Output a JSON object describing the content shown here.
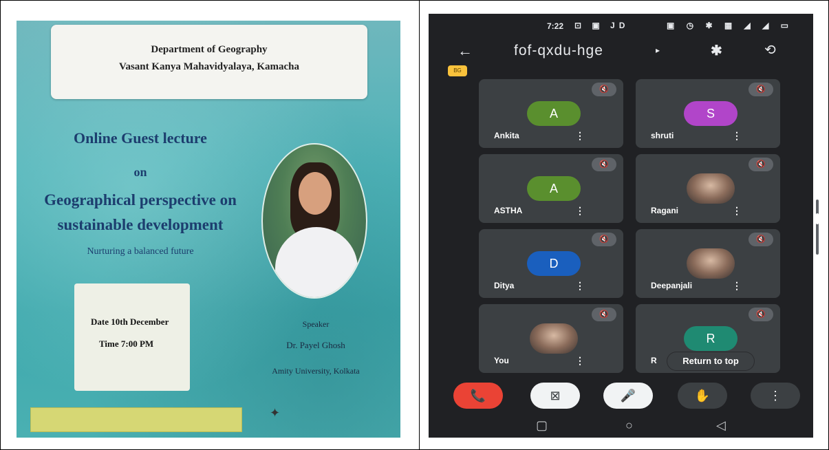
{
  "poster": {
    "dept": "Department of Geography",
    "college": "Vasant Kanya Mahavidyalaya, Kamacha",
    "line1": "Online Guest lecture",
    "line2": "on",
    "line3": "Geographical perspective on",
    "line4": "sustainable development",
    "line5": "Nurturing a balanced future",
    "date": "Date  10th December",
    "time": "Time  7:00 PM",
    "speaker_label": "Speaker",
    "speaker_name": "Dr. Payel Ghosh",
    "speaker_affil": "Amity University, Kolkata"
  },
  "phone": {
    "status_time": "7:22",
    "status_left_icons": "⊡ ▣ JD",
    "status_right_icons": "▣ ◷ ✱ ▦ ◢ ◢ ▭",
    "meeting_code": "fof-qxdu-hge",
    "chip": "BG",
    "participants": [
      {
        "name": "Ankita",
        "initial": "A",
        "color": "#5a8f2e",
        "photo": false
      },
      {
        "name": "shruti",
        "initial": "S",
        "color": "#b145c9",
        "photo": false
      },
      {
        "name": "ASTHA",
        "initial": "A",
        "color": "#5a8f2e",
        "photo": false
      },
      {
        "name": "Ragani",
        "initial": "",
        "color": "",
        "photo": true
      },
      {
        "name": "Ditya",
        "initial": "D",
        "color": "#1a5fbe",
        "photo": false
      },
      {
        "name": "Deepanjali",
        "initial": "",
        "color": "",
        "photo": true
      },
      {
        "name": "You",
        "initial": "",
        "color": "",
        "photo": true
      },
      {
        "name": "R",
        "initial": "R",
        "color": "#1f8a72",
        "photo": false
      }
    ],
    "return_label": "Return to top",
    "controls": {
      "end_call": "📞",
      "camera_off": "⊠",
      "mic_off": "🎤",
      "raise_hand": "✋",
      "more": "⋮"
    },
    "nav": {
      "recents": "▢",
      "home": "○",
      "back": "◁"
    }
  }
}
